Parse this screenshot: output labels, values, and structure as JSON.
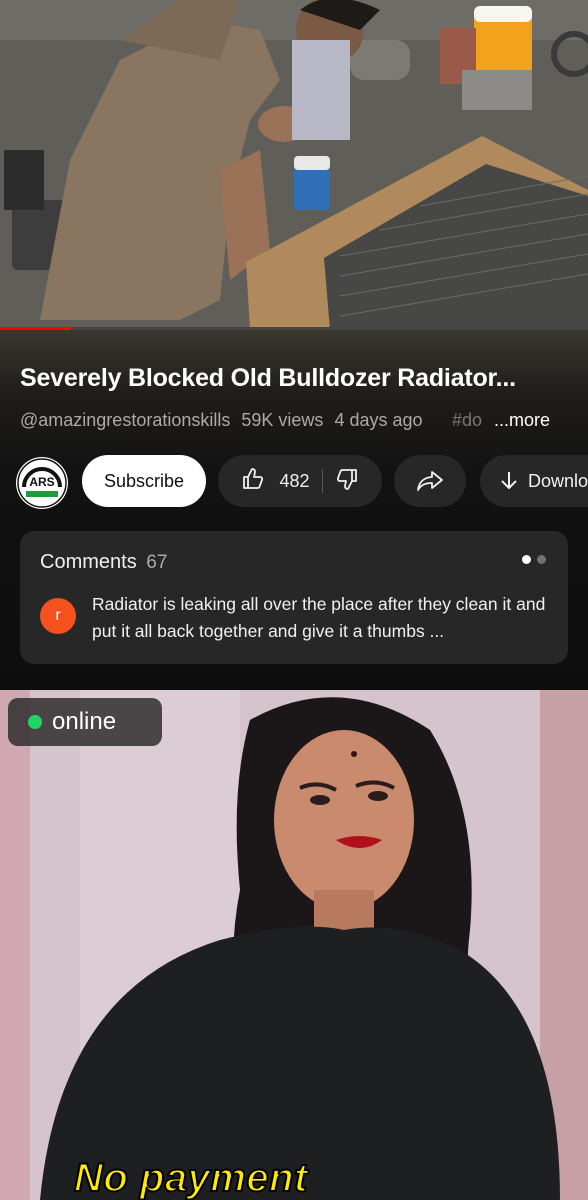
{
  "video": {
    "progress": 0.12,
    "progress_color": "#ff0000"
  },
  "info": {
    "title": "Severely Blocked Old Bulldozer Radiator...",
    "channel_handle": "@amazingrestorationskills",
    "views": "59K views",
    "age": "4 days ago",
    "hashtag": "#do",
    "more": "...more"
  },
  "actions": {
    "channel_logo": "ARS",
    "subscribe_label": "Subscribe",
    "like_count": "482",
    "download_label": "Download",
    "icons": [
      "thumbs-up-icon",
      "thumbs-down-icon",
      "share-icon",
      "download-icon"
    ]
  },
  "comments": {
    "label": "Comments",
    "count": "67",
    "first_comment_avatar": "r",
    "first_comment_text": "Radiator is leaking all over the place after they clean it and put it all back together and give it a thumbs ...",
    "avatar_color": "#f4511e"
  },
  "ad": {
    "status_label": "online",
    "status_color": "#1ed760",
    "caption": "No payment"
  }
}
